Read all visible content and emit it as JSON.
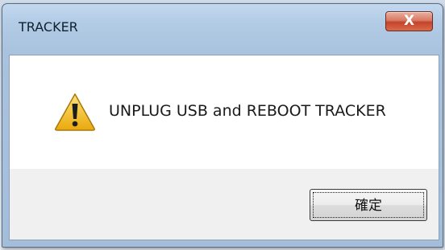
{
  "dialog": {
    "title": "TRACKER",
    "close_label": "X",
    "icon": "warning-icon",
    "message": "UNPLUG USB and REBOOT TRACKER",
    "ok_label": "確定"
  },
  "colors": {
    "title_bar": "#b3cce6",
    "close_button": "#c4432a",
    "content_bg": "#ffffff",
    "footer_bg": "#f0f0f0",
    "warning_yellow": "#f2c21b"
  }
}
